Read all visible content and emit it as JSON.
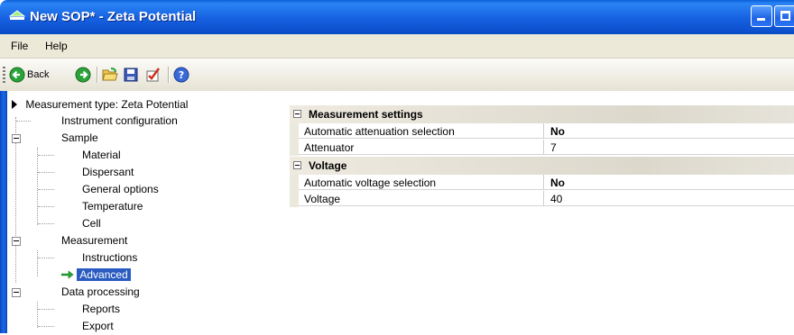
{
  "window": {
    "title": "New SOP* - Zeta Potential"
  },
  "menu": {
    "items": [
      "File",
      "Help"
    ]
  },
  "toolbar": {
    "back_label": "Back"
  },
  "tree": {
    "root_label": "Measurement type: Zeta Potential",
    "items": [
      "Instrument configuration",
      "Sample",
      "Material",
      "Dispersant",
      "General options",
      "Temperature",
      "Cell",
      "Measurement",
      "Instructions",
      "Advanced",
      "Data processing",
      "Reports",
      "Export"
    ],
    "selected": "Advanced"
  },
  "properties": {
    "categories": [
      {
        "label": "Measurement settings",
        "rows": [
          {
            "name": "Automatic attenuation selection",
            "value": "No"
          },
          {
            "name": "Attenuator",
            "value": "7"
          }
        ]
      },
      {
        "label": "Voltage",
        "rows": [
          {
            "name": "Automatic voltage selection",
            "value": "No"
          },
          {
            "name": "Voltage",
            "value": "40"
          }
        ]
      }
    ]
  },
  "colors": {
    "titlebar": "#1660e0",
    "selection": "#2a5bc0",
    "chrome": "#ece9d8"
  }
}
